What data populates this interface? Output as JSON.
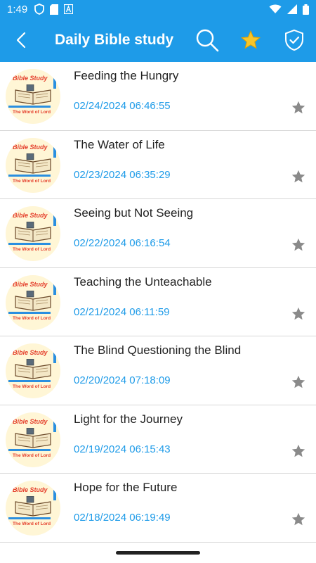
{
  "status": {
    "time": "1:49"
  },
  "app": {
    "title": "Daily Bible study"
  },
  "thumb": {
    "line1": "Bible Study",
    "line2": "The Word of Lord"
  },
  "items": [
    {
      "title": "Feeding the Hungry",
      "date": "02/24/2024 06:46:55"
    },
    {
      "title": "The Water of Life",
      "date": "02/23/2024 06:35:29"
    },
    {
      "title": "Seeing but Not Seeing",
      "date": "02/22/2024 06:16:54"
    },
    {
      "title": "Teaching the Unteachable",
      "date": "02/21/2024 06:11:59"
    },
    {
      "title": "The Blind Questioning the Blind",
      "date": "02/20/2024 07:18:09"
    },
    {
      "title": "Light for the Journey",
      "date": "02/19/2024 06:15:43"
    },
    {
      "title": "Hope for the Future",
      "date": "02/18/2024 06:19:49"
    }
  ],
  "colors": {
    "primary": "#1e9be8",
    "star_inactive": "#8a8a8a",
    "star_active": "#f5c518"
  },
  "icons": {
    "back": "back-arrow-icon",
    "search": "search-icon",
    "favorites": "star-icon",
    "shield": "shield-check-icon"
  }
}
